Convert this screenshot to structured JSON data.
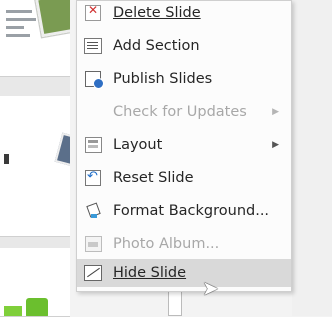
{
  "context_menu": {
    "items": [
      {
        "label": "Delete Slide",
        "underline": "D",
        "icon": "delete-slide-icon",
        "enabled": true
      },
      {
        "label": "Add Section",
        "underline": "A",
        "icon": "add-section-icon",
        "enabled": true
      },
      {
        "label": "Publish Slides",
        "underline": "",
        "icon": "publish-slides-icon",
        "enabled": true
      },
      {
        "label": "Check for Updates",
        "underline": "U",
        "icon": "",
        "enabled": false,
        "submenu": true
      },
      {
        "label": "Layout",
        "underline": "",
        "icon": "layout-icon",
        "enabled": true,
        "submenu": true
      },
      {
        "label": "Reset Slide",
        "underline": "R",
        "icon": "reset-slide-icon",
        "enabled": true
      },
      {
        "label": "Format Background...",
        "underline": "B",
        "icon": "format-background-icon",
        "enabled": true
      },
      {
        "label": "Photo Album...",
        "underline": "P",
        "icon": "photo-album-icon",
        "enabled": false
      },
      {
        "label": "Hide Slide",
        "underline": "H",
        "icon": "hide-slide-icon",
        "enabled": true,
        "hovered": true
      }
    ],
    "submenu_arrow": "▶"
  },
  "colors": {
    "menu_bg": "#fcfcfc",
    "hover_bg": "#d9d9d9",
    "disabled_text": "#a8a8a8",
    "text": "#262626"
  }
}
